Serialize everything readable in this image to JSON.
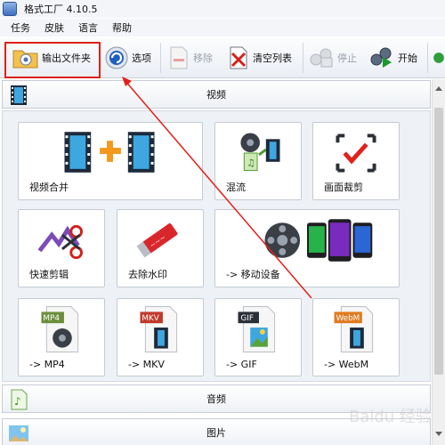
{
  "window": {
    "title": "格式工厂 4.10.5"
  },
  "menu": [
    "任务",
    "皮肤",
    "语言",
    "帮助"
  ],
  "toolbar": {
    "output_folder": "输出文件夹",
    "options": "选项",
    "remove": "移除",
    "clear_list": "清空列表",
    "stop": "停止",
    "start": "开始"
  },
  "sections": {
    "video": "视频",
    "audio": "音频",
    "picture": "图片"
  },
  "tiles": [
    {
      "label": "视频合并",
      "icon": "video-merge-icon"
    },
    {
      "label": "混流",
      "icon": "mux-icon"
    },
    {
      "label": "画面裁剪",
      "icon": "crop-icon"
    },
    {
      "label": "快速剪辑",
      "icon": "quick-clip-icon"
    },
    {
      "label": "去除水印",
      "icon": "remove-watermark-icon"
    },
    {
      "label": "-> 移动设备",
      "icon": "mobile-device-icon"
    },
    {
      "label": "-> MP4",
      "icon": "mp4-file-icon",
      "badge": "MP4"
    },
    {
      "label": "-> MKV",
      "icon": "mkv-file-icon",
      "badge": "MKV"
    },
    {
      "label": "-> GIF",
      "icon": "gif-file-icon",
      "badge": "GIF"
    },
    {
      "label": "-> WebM",
      "icon": "webm-file-icon",
      "badge": "WebM"
    }
  ],
  "colors": {
    "highlight": "#e0211a",
    "start_green": "#1a9a2b"
  },
  "watermark": "Baidu 经验"
}
